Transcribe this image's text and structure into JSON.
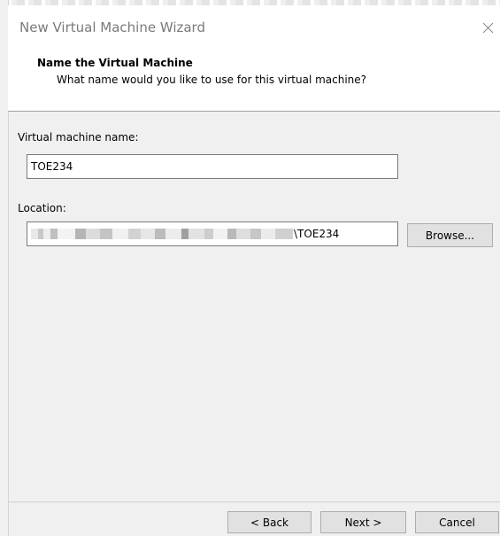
{
  "window": {
    "title": "New Virtual Machine Wizard"
  },
  "header": {
    "title": "Name the Virtual Machine",
    "subtitle": "What name would you like to use for this virtual machine?"
  },
  "form": {
    "vm_name_label": "Virtual machine name:",
    "vm_name_value": "TOE234",
    "location_label": "Location:",
    "location_value_suffix": "\\TOE234",
    "browse_label": "Browse..."
  },
  "footer": {
    "back_label": "< Back",
    "next_label": "Next >",
    "cancel_label": "Cancel"
  },
  "icons": {
    "close": "close-icon"
  },
  "colors": {
    "title_text": "#7a7a7a",
    "panel_bg": "#f0f0f0",
    "button_bg": "#e1e1e1",
    "button_border": "#adadad"
  }
}
